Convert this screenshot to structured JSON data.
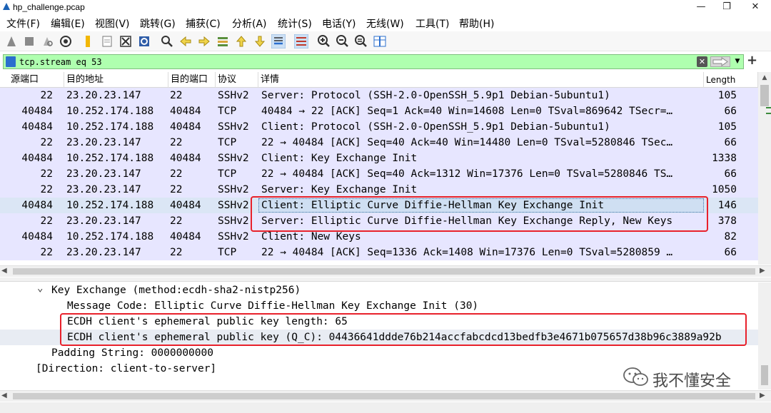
{
  "window": {
    "title": "hp_challenge.pcap",
    "minimize": "—",
    "restore": "❐",
    "close": "✕"
  },
  "menu": [
    "文件(F)",
    "编辑(E)",
    "视图(V)",
    "跳转(G)",
    "捕获(C)",
    "分析(A)",
    "统计(S)",
    "电话(Y)",
    "无线(W)",
    "工具(T)",
    "帮助(H)"
  ],
  "filter": {
    "value": "tcp.stream eq 53",
    "clear_glyph": "✕",
    "dropdown_glyph": "▼",
    "add_glyph": "+"
  },
  "packet_list": {
    "columns": [
      "源端口",
      "目的地址",
      "目的端口",
      "协议",
      "详情",
      "Length"
    ],
    "rows": [
      {
        "src_port": "22",
        "dst_addr": "23.20.23.147",
        "dst_port": "22",
        "proto": "SSHv2",
        "info": "Server: Protocol (SSH-2.0-OpenSSH_5.9p1 Debian-5ubuntu1)",
        "length": "105"
      },
      {
        "src_port": "40484",
        "dst_addr": "10.252.174.188",
        "dst_port": "40484",
        "proto": "TCP",
        "info": "40484 → 22 [ACK] Seq=1 Ack=40 Win=14608 Len=0 TSval=869642 TSecr=…",
        "length": "66"
      },
      {
        "src_port": "40484",
        "dst_addr": "10.252.174.188",
        "dst_port": "40484",
        "proto": "SSHv2",
        "info": "Client: Protocol (SSH-2.0-OpenSSH_5.9p1 Debian-5ubuntu1)",
        "length": "105"
      },
      {
        "src_port": "22",
        "dst_addr": "23.20.23.147",
        "dst_port": "22",
        "proto": "TCP",
        "info": "22 → 40484 [ACK] Seq=40 Ack=40 Win=14480 Len=0 TSval=5280846 TSec…",
        "length": "66"
      },
      {
        "src_port": "40484",
        "dst_addr": "10.252.174.188",
        "dst_port": "40484",
        "proto": "SSHv2",
        "info": "Client: Key Exchange Init",
        "length": "1338"
      },
      {
        "src_port": "22",
        "dst_addr": "23.20.23.147",
        "dst_port": "22",
        "proto": "TCP",
        "info": "22 → 40484 [ACK] Seq=40 Ack=1312 Win=17376 Len=0 TSval=5280846 TS…",
        "length": "66"
      },
      {
        "src_port": "22",
        "dst_addr": "23.20.23.147",
        "dst_port": "22",
        "proto": "SSHv2",
        "info": "Server: Key Exchange Init",
        "length": "1050"
      },
      {
        "src_port": "40484",
        "dst_addr": "10.252.174.188",
        "dst_port": "40484",
        "proto": "SSHv2",
        "info": "Client: Elliptic Curve Diffie-Hellman Key Exchange Init",
        "length": "146"
      },
      {
        "src_port": "22",
        "dst_addr": "23.20.23.147",
        "dst_port": "22",
        "proto": "SSHv2",
        "info": "Server: Elliptic Curve Diffie-Hellman Key Exchange Reply, New Keys",
        "length": "378"
      },
      {
        "src_port": "40484",
        "dst_addr": "10.252.174.188",
        "dst_port": "40484",
        "proto": "SSHv2",
        "info": "Client: New Keys",
        "length": "82"
      },
      {
        "src_port": "22",
        "dst_addr": "23.20.23.147",
        "dst_port": "22",
        "proto": "TCP",
        "info": "22 → 40484 [ACK] Seq=1336 Ack=1408 Win=17376 Len=0 TSval=5280859 …",
        "length": "66"
      }
    ]
  },
  "details": {
    "lines": [
      "Key Exchange (method:ecdh-sha2-nistp256)",
      "Message Code: Elliptic Curve Diffie-Hellman Key Exchange Init (30)",
      "ECDH client's ephemeral public key length: 65",
      "ECDH client's ephemeral public key (Q_C): 04436641ddde76b214accfabcdcd13bedfb3e4671b075657d38b96c3889a92b",
      "Padding String: 0000000000",
      "[Direction: client-to-server]"
    ],
    "caret": "⌄"
  },
  "watermark": {
    "text": "我不懂安全"
  },
  "colors": {
    "filter_bg": "#afffaf",
    "row_bg": "#e7e6ff",
    "highlight": "#e8212b"
  }
}
